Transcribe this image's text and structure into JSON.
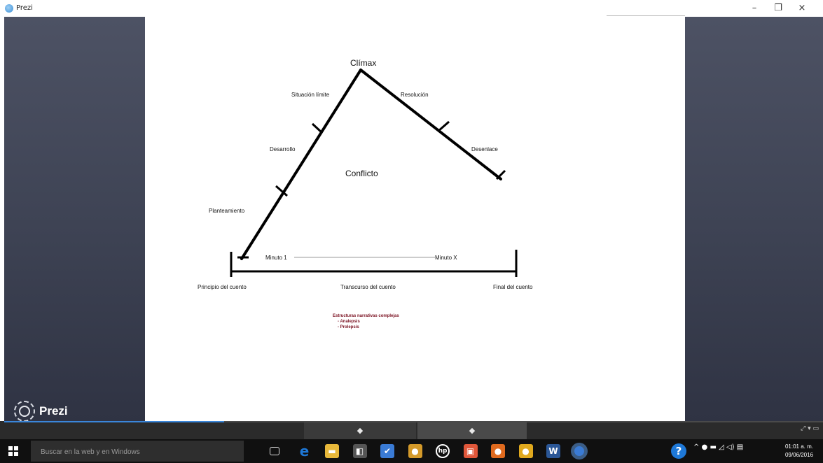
{
  "window": {
    "title": "Prezi",
    "minimize_glyph": "–",
    "restore_glyph": "❐",
    "close_glyph": "×"
  },
  "brand": {
    "logo_text": "Prezi"
  },
  "slide": {
    "labels": {
      "climax": "Clímax",
      "situacion_limite": "Situación límite",
      "resolucion": "Resolución",
      "desarrollo": "Desarrollo",
      "desenlace": "Desenlace",
      "conflicto": "Conflicto",
      "planteamiento": "Planteamiento",
      "minuto_1": "Minuto 1",
      "minuto_x": "Minuto X",
      "principio": "Principio del cuento",
      "transcurso": "Transcurso del cuento",
      "final": "Final del cuento"
    },
    "note": {
      "heading": "Estructuras narrativas complejas",
      "items": [
        "- Analepsis",
        "- Prolepsis"
      ],
      "color": "#7a1020"
    }
  },
  "controls": {
    "prev_glyph": "◆",
    "next_glyph": "◆",
    "right_icons": "⤢ ▾ ▭",
    "progress_color": "#3a86d9"
  },
  "taskbar": {
    "search_placeholder": "Buscar en la web y en Windows",
    "apps": [
      {
        "name": "task-view-icon",
        "glyph": "▭",
        "color": "#101010"
      },
      {
        "name": "edge-icon",
        "glyph": "e",
        "color": "#1e78d7"
      },
      {
        "name": "file-explorer-icon",
        "glyph": "▬",
        "color": "#e8b83a"
      },
      {
        "name": "store-icon",
        "glyph": "◧",
        "color": "#555555"
      },
      {
        "name": "app-checklist-icon",
        "glyph": "✔",
        "color": "#3a7bd5"
      },
      {
        "name": "app-figure-icon",
        "glyph": "●",
        "color": "#d49a2a"
      },
      {
        "name": "hp-icon",
        "glyph": "hp",
        "color": "#101010"
      },
      {
        "name": "app-red-icon",
        "glyph": "▣",
        "color": "#e0573a"
      },
      {
        "name": "firefox-icon",
        "glyph": "●",
        "color": "#e06a1e"
      },
      {
        "name": "chrome-icon",
        "glyph": "●",
        "color": "#e0a91e"
      },
      {
        "name": "word-icon",
        "glyph": "W",
        "color": "#2b5797"
      },
      {
        "name": "prezi-taskbar-icon",
        "glyph": "",
        "color": "#3a7bd5"
      }
    ],
    "help_glyph": "?",
    "tray_glyphs": "^  ●  ▬  ◿  ◁)  ▤",
    "time": "01:01 a. m.",
    "date": "09/06/2016"
  }
}
